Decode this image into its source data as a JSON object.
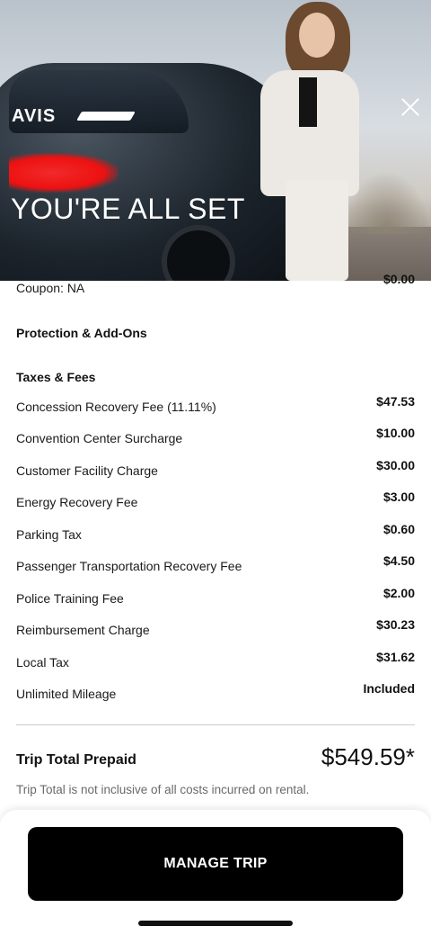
{
  "hero": {
    "brand": "AVIS",
    "headline": "YOU'RE ALL SET"
  },
  "coupon": {
    "label": "Coupon: NA",
    "amount": "$0.00"
  },
  "protection": {
    "title": "Protection & Add-Ons"
  },
  "taxes": {
    "title": "Taxes & Fees",
    "items": [
      {
        "label": "Concession Recovery Fee (11.11%)",
        "amount": "$47.53"
      },
      {
        "label": "Convention Center Surcharge",
        "amount": "$10.00"
      },
      {
        "label": "Customer Facility Charge",
        "amount": "$30.00"
      },
      {
        "label": "Energy Recovery Fee",
        "amount": "$3.00"
      },
      {
        "label": "Parking Tax",
        "amount": "$0.60"
      },
      {
        "label": "Passenger Transportation Recovery Fee",
        "amount": "$4.50"
      },
      {
        "label": "Police Training Fee",
        "amount": "$2.00"
      },
      {
        "label": "Reimbursement Charge",
        "amount": "$30.23"
      },
      {
        "label": "Local Tax",
        "amount": "$31.62"
      },
      {
        "label": "Unlimited Mileage",
        "amount": "Included"
      }
    ]
  },
  "total": {
    "label": "Trip Total Prepaid",
    "amount": "$549.59*",
    "note": "Trip Total is not inclusive of all costs incurred on rental."
  },
  "actions": {
    "manage_label": "MANAGE TRIP"
  },
  "colors": {
    "accent": "#000000",
    "redaction": "#e11111"
  }
}
